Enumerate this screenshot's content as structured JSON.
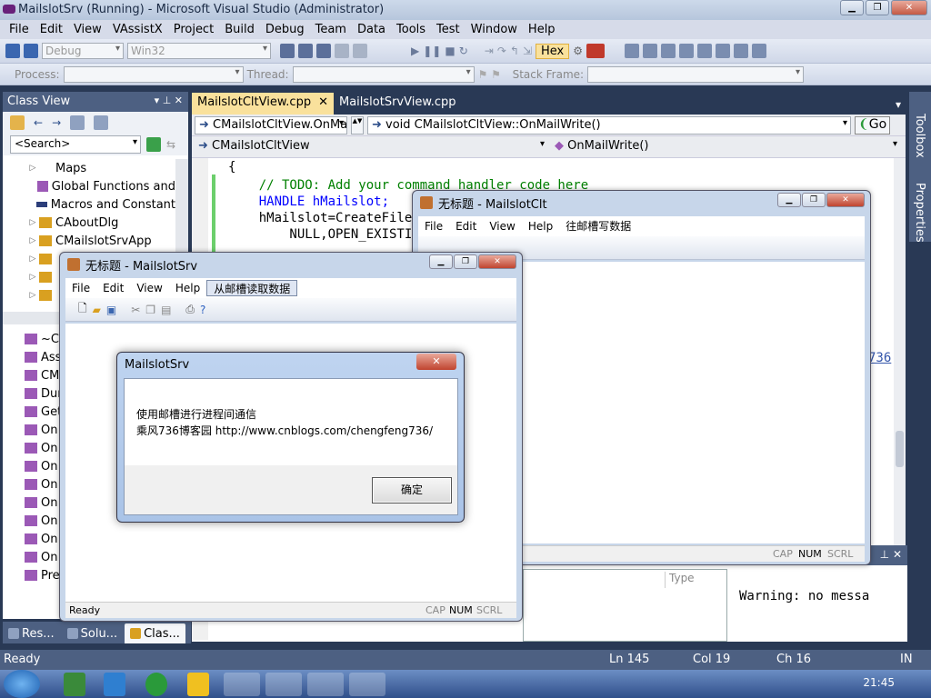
{
  "vs": {
    "title": "MailslotSrv (Running) - Microsoft Visual Studio (Administrator)",
    "menu": [
      "File",
      "Edit",
      "View",
      "VAssistX",
      "Project",
      "Build",
      "Debug",
      "Team",
      "Data",
      "Tools",
      "Test",
      "Window",
      "Help"
    ],
    "config": "Debug",
    "platform": "Win32",
    "hex_label": "Hex",
    "process_label": "Process:",
    "thread_label": "Thread:",
    "stack_frame_label": "Stack Frame:"
  },
  "class_view": {
    "title": "Class View",
    "search_placeholder": "<Search>",
    "items": [
      "Maps",
      "Global Functions and",
      "Macros and Constant",
      "CAboutDlg",
      "CMailslotSrvApp"
    ],
    "members": [
      "~C",
      "Ass",
      "CM",
      "Dur",
      "Get",
      "On",
      "On",
      "On",
      "On",
      "On",
      "On",
      "On",
      "On",
      "Pre"
    ]
  },
  "bottom_tabs": [
    "Res...",
    "Solu...",
    "Clas..."
  ],
  "editor": {
    "tabs": [
      "MailslotCltView.cpp",
      "MailslotSrvView.cpp"
    ],
    "nav_class": "CMailslotCltView.OnMail",
    "nav_func": "void CMailslotCltView::OnMailWrite()",
    "go": "Go",
    "nav_class2": "CMailslotCltView",
    "nav_member2": "OnMailWrite()",
    "code": [
      "{",
      "    // TODO: Add your command handler code here",
      "    HANDLE hMailslot;",
      "    hMailslot=CreateFile(",
      "        NULL,OPEN_EXISTIN"
    ],
    "partial_link": "736"
  },
  "right_tabs": [
    "Toolbox",
    "Properties"
  ],
  "error_list": {
    "column": "Type"
  },
  "output": {
    "text": "Warning: no messa"
  },
  "status": {
    "ready": "Ready",
    "ln": "Ln 145",
    "col": "Col 19",
    "ch": "Ch 16",
    "ins": "IN"
  },
  "taskbar": {
    "clock": "21:45"
  },
  "client_window": {
    "title": "无标题 - MailslotClt",
    "menu": [
      "File",
      "Edit",
      "View",
      "Help",
      "往邮槽写数据"
    ],
    "indicators": [
      "CAP",
      "NUM",
      "SCRL"
    ]
  },
  "server_window": {
    "title": "无标题 - MailslotSrv",
    "menu": [
      "File",
      "Edit",
      "View",
      "Help",
      "从邮槽读取数据"
    ],
    "status": "Ready",
    "indicators": [
      "CAP",
      "NUM",
      "SCRL"
    ]
  },
  "message_box": {
    "title": "MailslotSrv",
    "line1": "使用邮槽进行进程间通信",
    "line2": "乘风736博客园 http://www.cnblogs.com/chengfeng736/",
    "ok": "确定"
  },
  "colors": {
    "accent": "#4d6082",
    "tab_active": "#f9e19c",
    "comment": "#008000",
    "keyword": "#0000ff"
  }
}
